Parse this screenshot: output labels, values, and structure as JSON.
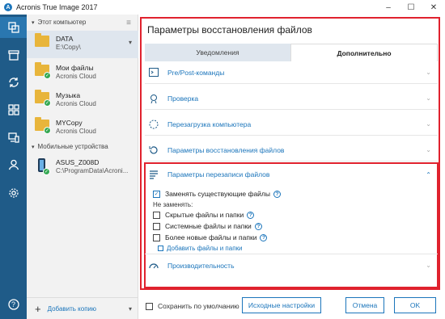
{
  "window": {
    "title": "Acronis True Image 2017",
    "controls": [
      "–",
      "☐",
      "✕"
    ]
  },
  "nav": {
    "icons": [
      "copy-icon",
      "archive-icon",
      "sync-icon",
      "dashboard-icon",
      "devices-icon",
      "account-icon",
      "settings-icon",
      "help-icon"
    ],
    "help_label": "?"
  },
  "sidebar": {
    "section_computer": "Этот компьютер",
    "items": [
      {
        "name": "DATA",
        "sub": "E:\\Copy\\"
      },
      {
        "name": "Мои файлы",
        "sub": "Acronis Cloud"
      },
      {
        "name": "Музыка",
        "sub": "Acronis Cloud"
      },
      {
        "name": "MYCopy",
        "sub": "Acronis Cloud"
      }
    ],
    "section_mobile": "Мобильные устройства",
    "device": {
      "name": "ASUS_Z008D",
      "sub": "C:\\ProgramData\\Acroni..."
    },
    "add_copy": "Добавить копию"
  },
  "panel": {
    "title": "Параметры восстановления файлов",
    "tabs": [
      "Уведомления",
      "Дополнительно"
    ],
    "sections": [
      {
        "label": "Pre/Post-команды",
        "icon": "terminal-icon"
      },
      {
        "label": "Проверка",
        "icon": "verify-icon"
      },
      {
        "label": "Перезагрузка компьютера",
        "icon": "restart-icon"
      },
      {
        "label": "Параметры восстановления файлов",
        "icon": "restore-icon"
      },
      {
        "label": "Параметры перезаписи файлов",
        "icon": "overwrite-icon"
      },
      {
        "label": "Производительность",
        "icon": "performance-icon"
      }
    ],
    "overwrite": {
      "replace_existing": "Заменять существующие файлы",
      "do_not_replace": "Не заменять:",
      "hidden": "Скрытые файлы и папки",
      "system": "Системные файлы и папки",
      "newer": "Более новые файлы и папки",
      "add_files": "Добавить файлы и папки"
    }
  },
  "footer": {
    "save_default": "Сохранить по умолчанию",
    "reset": "Исходные настройки",
    "cancel": "Отмена",
    "ok": "OK"
  },
  "colors": {
    "accent": "#1b75bb",
    "nav_bg": "#1f5b88",
    "highlight_red": "#e0222e"
  }
}
